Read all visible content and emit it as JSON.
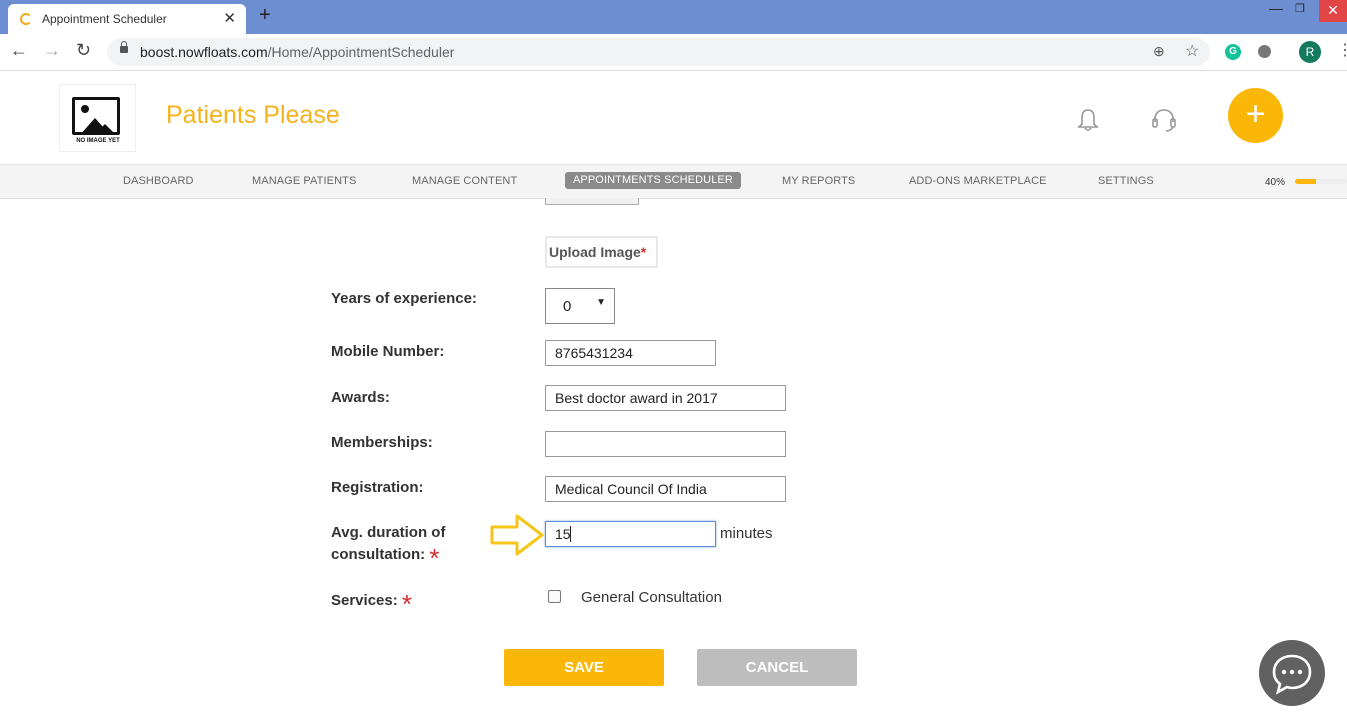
{
  "browser": {
    "tab_title": "Appointment Scheduler",
    "url_host": "boost.nowfloats.com",
    "url_path": "/Home/AppointmentScheduler",
    "profile_initial": "R",
    "extension_letter": "G"
  },
  "header": {
    "logo_caption": "NO IMAGE YET",
    "brand_name": "Patients Please",
    "brand_color": "#f6b21b",
    "accent_color": "#fbb708",
    "add_label": "+"
  },
  "nav": {
    "items": [
      {
        "label": "DASHBOARD"
      },
      {
        "label": "MANAGE PATIENTS"
      },
      {
        "label": "MANAGE CONTENT"
      },
      {
        "label": "APPOINTMENTS SCHEDULER",
        "active": true
      },
      {
        "label": "MY REPORTS"
      },
      {
        "label": "ADD-ONS MARKETPLACE"
      },
      {
        "label": "SETTINGS"
      }
    ],
    "progress_text": "40%",
    "progress_value": 0.4
  },
  "form": {
    "upload_label": "Upload Image",
    "required_mark": "*",
    "experience": {
      "label": "Years of experience:",
      "value": "0"
    },
    "mobile": {
      "label": "Mobile Number:",
      "value": "8765431234"
    },
    "awards": {
      "label": "Awards:",
      "value": "Best doctor award in 2017"
    },
    "memberships": {
      "label": "Memberships:",
      "value": ""
    },
    "registration": {
      "label": "Registration:",
      "value": "Medical Council Of India"
    },
    "duration": {
      "label_line1": "Avg. duration of",
      "label_line2": "consultation:",
      "value": "15",
      "unit": "minutes"
    },
    "services": {
      "label": "Services:",
      "option": "General Consultation",
      "checked": false
    }
  },
  "actions": {
    "save_label": "SAVE",
    "cancel_label": "CANCEL"
  }
}
